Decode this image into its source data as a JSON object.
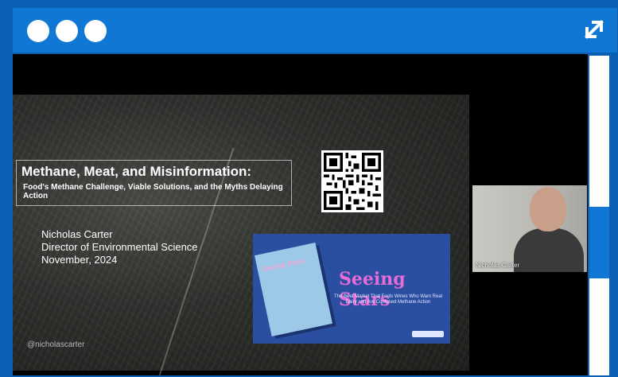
{
  "window": {
    "dots": [
      "dot",
      "dot",
      "dot"
    ],
    "expand_icon": "expand-diagonal-icon",
    "colors": {
      "frame": "#0b60b5",
      "topbar": "#1078d4",
      "scroll_thumb": "#1078d4"
    }
  },
  "slide": {
    "title": "Methane, Meat, and Misinformation:",
    "subtitle": "Food's Methane Challenge, Viable Solutions, and the Myths Delaying Action",
    "presenter_name": "Nicholas Carter",
    "presenter_role": "Director of Environmental Science",
    "date": "November, 2024",
    "handle": "@nicholascarter",
    "qr_icon": "qr-code-icon"
  },
  "book_ad": {
    "book_title": "Seeing Stars",
    "headline": "Seeing Stars",
    "tagline": "The Beef Market That Fools Wines Who Want Real Dairy and Are Confused Methane Action"
  },
  "camera": {
    "label": "Nicholas Carter"
  }
}
